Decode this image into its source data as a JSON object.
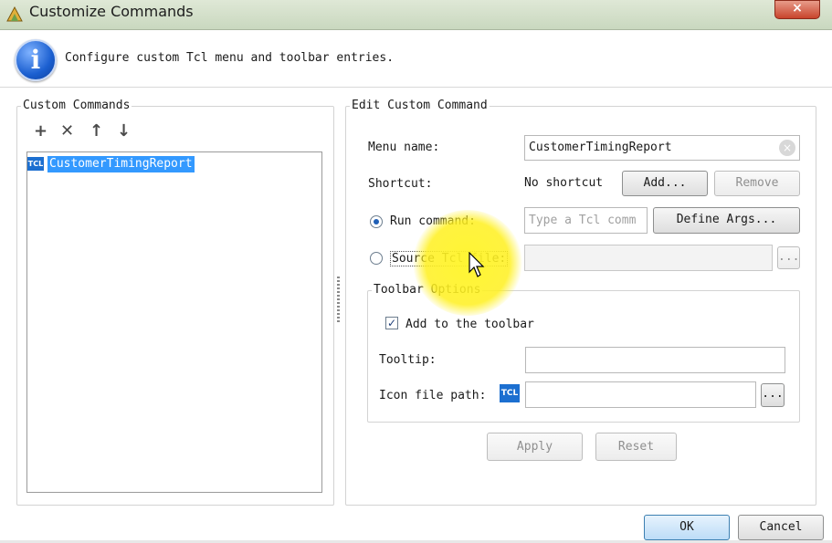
{
  "window": {
    "title": "Customize Commands",
    "close_glyph": "×"
  },
  "banner": {
    "text": "Configure custom Tcl menu and toolbar entries."
  },
  "left_panel": {
    "legend": "Custom Commands",
    "toolbar_icons": [
      "plus-icon",
      "delete-x-icon",
      "move-up-icon",
      "move-down-icon"
    ],
    "items": [
      {
        "label": "CustomerTimingReport",
        "icon": "tcl-icon",
        "icon_text": "TCL",
        "selected": true
      }
    ]
  },
  "right_panel": {
    "legend": "Edit Custom Command",
    "menu_name_label": "Menu name:",
    "menu_name_value": "CustomerTimingReport",
    "shortcut_label": "Shortcut:",
    "shortcut_value": "No shortcut",
    "add_button": "Add...",
    "remove_button": "Remove",
    "run_command_label": "Run command:",
    "run_command_placeholder": "Type a Tcl comm",
    "define_args_button": "Define Args...",
    "source_file_label": "Source Tcl file:",
    "browse_glyph": "...",
    "selected_mode": "run_command",
    "toolbar_options": {
      "legend": "Toolbar Options",
      "add_to_toolbar_label": "Add to the toolbar",
      "add_to_toolbar_checked": true,
      "tooltip_label": "Tooltip:",
      "icon_path_label": "Icon file path:",
      "icon_text": "TCL"
    },
    "apply_button": "Apply",
    "reset_button": "Reset"
  },
  "footer": {
    "ok_button": "OK",
    "cancel_button": "Cancel"
  }
}
